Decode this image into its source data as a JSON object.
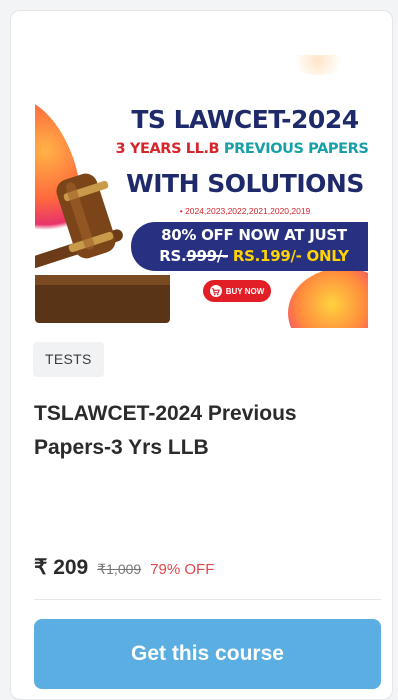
{
  "banner": {
    "title": "TS LAWCET-2024",
    "sub_red": "3 YEARS LL.B",
    "sub_teal": "PREVIOUS PAPERS",
    "with_solutions": "WITH SOLUTIONS",
    "years": "• 2024,2023,2022,2021,2020,2019",
    "offer_line1": "80% OFF NOW AT JUST",
    "offer_old_prefix": "RS.",
    "offer_old_price": "999/-",
    "offer_new": "RS.199/- ONLY",
    "buy_now": "BUY NOW"
  },
  "card": {
    "tag": "TESTS",
    "title": "TSLAWCET-2024 Previous Papers-3 Yrs LLB",
    "price": "₹ 209",
    "old_price": "₹1,009",
    "discount": "79% OFF",
    "cta": "Get this course"
  },
  "colors": {
    "cta": "#5aaee2",
    "discount": "#e0474c",
    "banner_navy": "#1f2a6b",
    "banner_red": "#d5262b",
    "banner_teal": "#18a0a8",
    "offer_yellow": "#ffd400"
  },
  "icons": {
    "gavel": "gavel-icon",
    "cart": "cart-icon"
  }
}
